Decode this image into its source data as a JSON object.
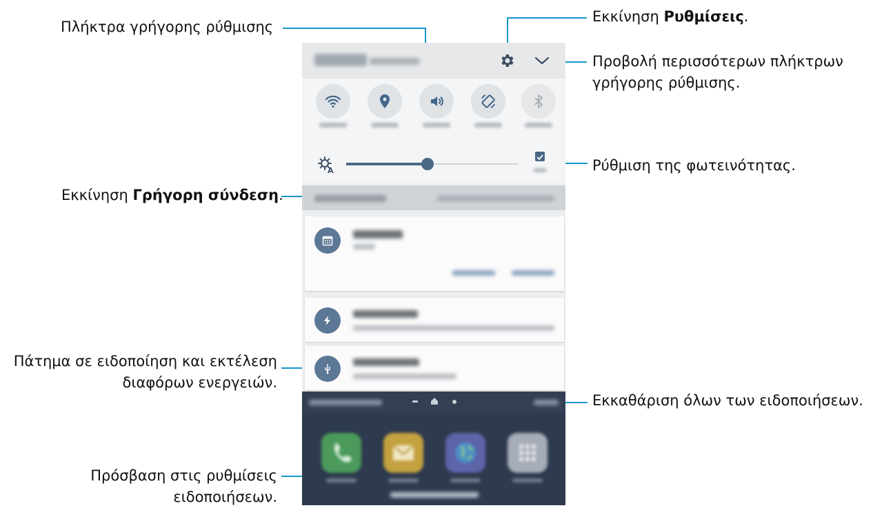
{
  "callouts": {
    "quick_setting_buttons": "Πλήκτρα γρήγορης ρύθμισης",
    "launch_settings_prefix": "Εκκίνηση ",
    "launch_settings_bold": "Ρυθμίσεις",
    "launch_settings_suffix": ".",
    "more_buttons_line1": "Προβολή περισσότερων πλήκτρων",
    "more_buttons_line2": "γρήγορης ρύθμισης.",
    "brightness": "Ρύθμιση της φωτεινότητας.",
    "quick_connect_prefix": "Εκκίνηση ",
    "quick_connect_bold": "Γρήγορη σύνδεση",
    "quick_connect_suffix": ".",
    "tap_notification_line1": "Πάτημα σε ειδοποίηση και εκτέλεση",
    "tap_notification_line2": "διαφόρων ενεργειών.",
    "clear_all": "Εκκαθάριση όλων των ειδοποιήσεων.",
    "notif_settings_line1": "Πρόσβαση στις ρυθμίσεις",
    "notif_settings_line2": "ειδοποιήσεων."
  },
  "phone": {
    "quick_settings": [
      {
        "icon": "wifi-icon",
        "active": true
      },
      {
        "icon": "location-icon",
        "active": true
      },
      {
        "icon": "sound-icon",
        "active": true
      },
      {
        "icon": "auto-rotate-icon",
        "active": true
      },
      {
        "icon": "bluetooth-icon",
        "active": false
      }
    ],
    "brightness": {
      "level": 0.47,
      "auto": true
    },
    "notifications": [
      {
        "icon": "calendar-icon",
        "has_actions": true
      },
      {
        "icon": "flash-icon",
        "has_actions": false
      },
      {
        "icon": "usb-icon",
        "has_actions": false
      }
    ],
    "home_apps": [
      "phone-icon",
      "email-icon",
      "internet-icon",
      "apps-icon"
    ],
    "colors": {
      "accent": "#4a6885",
      "callout_line": "#1596c9"
    }
  }
}
